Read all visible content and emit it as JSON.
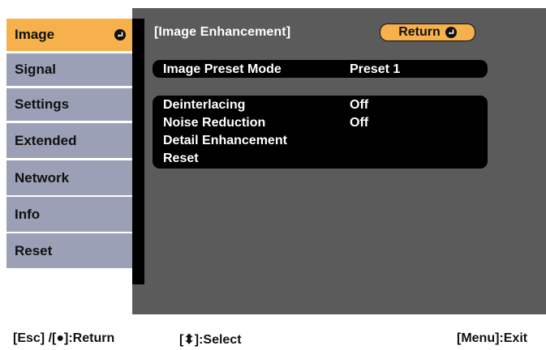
{
  "sidebar": {
    "items": [
      {
        "label": "Image"
      },
      {
        "label": "Signal"
      },
      {
        "label": "Settings"
      },
      {
        "label": "Extended"
      },
      {
        "label": "Network"
      },
      {
        "label": "Info"
      },
      {
        "label": "Reset"
      }
    ]
  },
  "header": {
    "title": "[Image Enhancement]",
    "return_label": "Return"
  },
  "settings": {
    "preset_mode": {
      "label": "Image Preset Mode",
      "value": "Preset 1"
    },
    "deinterlacing": {
      "label": "Deinterlacing",
      "value": "Off"
    },
    "noise_reduction": {
      "label": "Noise Reduction",
      "value": "Off"
    },
    "detail_enhancement": {
      "label": "Detail Enhancement"
    },
    "reset": {
      "label": "Reset"
    }
  },
  "footer": {
    "back_hint": "[Esc] /[●]:Return",
    "select_hint": "[⬍]:Select",
    "exit_hint": "[Menu]:Exit"
  },
  "colors": {
    "accent": "#f6b14c",
    "sidebar": "#9ba0b6",
    "panel": "#5b5b5b"
  },
  "icons": [
    "enter-icon",
    "up-down-arrows-icon"
  ]
}
